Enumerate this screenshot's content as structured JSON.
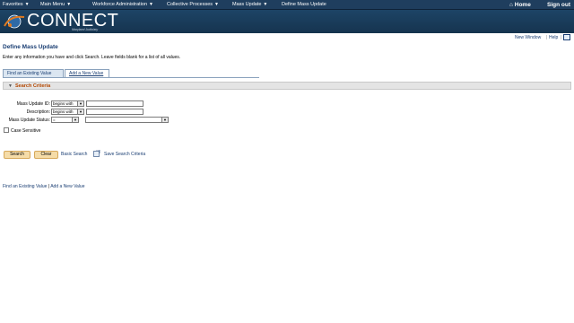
{
  "topnav": {
    "items": [
      {
        "label": "Favorites"
      },
      {
        "label": "Main Menu"
      },
      {
        "label": "Workforce Administration"
      },
      {
        "label": "Collective Processes"
      },
      {
        "label": "Mass Update"
      },
      {
        "label": "Define Mass Update"
      }
    ],
    "home_label": "Home",
    "signout_label": "Sign out"
  },
  "banner": {
    "logo_text": "CONNECT",
    "logo_sub": "Maryland Judiciary"
  },
  "utils": {
    "new_window": "New Window",
    "help": "Help"
  },
  "page": {
    "title": "Define Mass Update",
    "instructions": "Enter any information you have and click Search. Leave fields blank for a list of all values."
  },
  "tabs": [
    {
      "label": "Find an Existing Value"
    },
    {
      "label": "Add a New Value"
    }
  ],
  "search_criteria": {
    "header": "Search Criteria",
    "mass_update_id": {
      "label": "Mass Update ID:",
      "operator": "begins with",
      "value": ""
    },
    "description": {
      "label": "Description:",
      "operator": "begins with",
      "value": ""
    },
    "status": {
      "label": "Mass Update Status:",
      "operator": "=",
      "value": ""
    },
    "case_sensitive": {
      "label": "Case Sensitive",
      "checked": false
    }
  },
  "actions": {
    "search": "Search",
    "clear": "Clear",
    "basic_search": "Basic Search",
    "save_search": "Save Search Criteria"
  },
  "bottom_links": {
    "find_existing": "Find an Existing Value",
    "separator": "|",
    "add_new": "Add a New Value"
  },
  "colors": {
    "nav_bg": "#1f3e5e",
    "link": "#1a3e73",
    "section_title": "#b34700",
    "button_bg": "#f5dca8"
  }
}
